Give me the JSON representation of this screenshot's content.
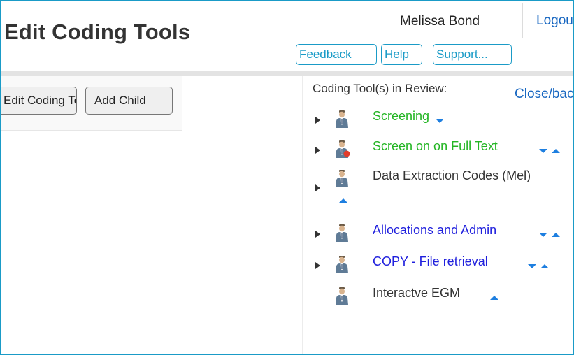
{
  "header": {
    "title": "Edit Coding Tools",
    "user_name": "Melissa Bond",
    "logout_label": "Logout",
    "links": {
      "feedback": "Feedback",
      "help": "Help",
      "support": "Support..."
    }
  },
  "toolbar": {
    "edit_tool_label": "Edit Coding Tool",
    "add_child_label": "Add Child"
  },
  "review": {
    "label": "Coding Tool(s) in Review:",
    "close_label": "Close/back",
    "items": [
      {
        "label": "Screening",
        "color": "#23b523",
        "icon": "person-icon"
      },
      {
        "label": "Screen on on Full Text",
        "color": "#23b523",
        "icon": "person-reviewer-icon"
      },
      {
        "label": "Data Extraction Codes (Mel)",
        "color": "#333333",
        "icon": "person-icon"
      },
      {
        "label": "Allocations and Admin",
        "color": "#2020dd",
        "icon": "person-icon"
      },
      {
        "label": "COPY - File retrieval",
        "color": "#2020dd",
        "icon": "person-icon"
      },
      {
        "label": "Interactve EGM",
        "color": "#333333",
        "icon": "person-icon"
      }
    ]
  },
  "colors": {
    "frame_border": "#1a9bc7",
    "link_blue": "#1565c0",
    "arrow_blue": "#1e7fe0"
  }
}
